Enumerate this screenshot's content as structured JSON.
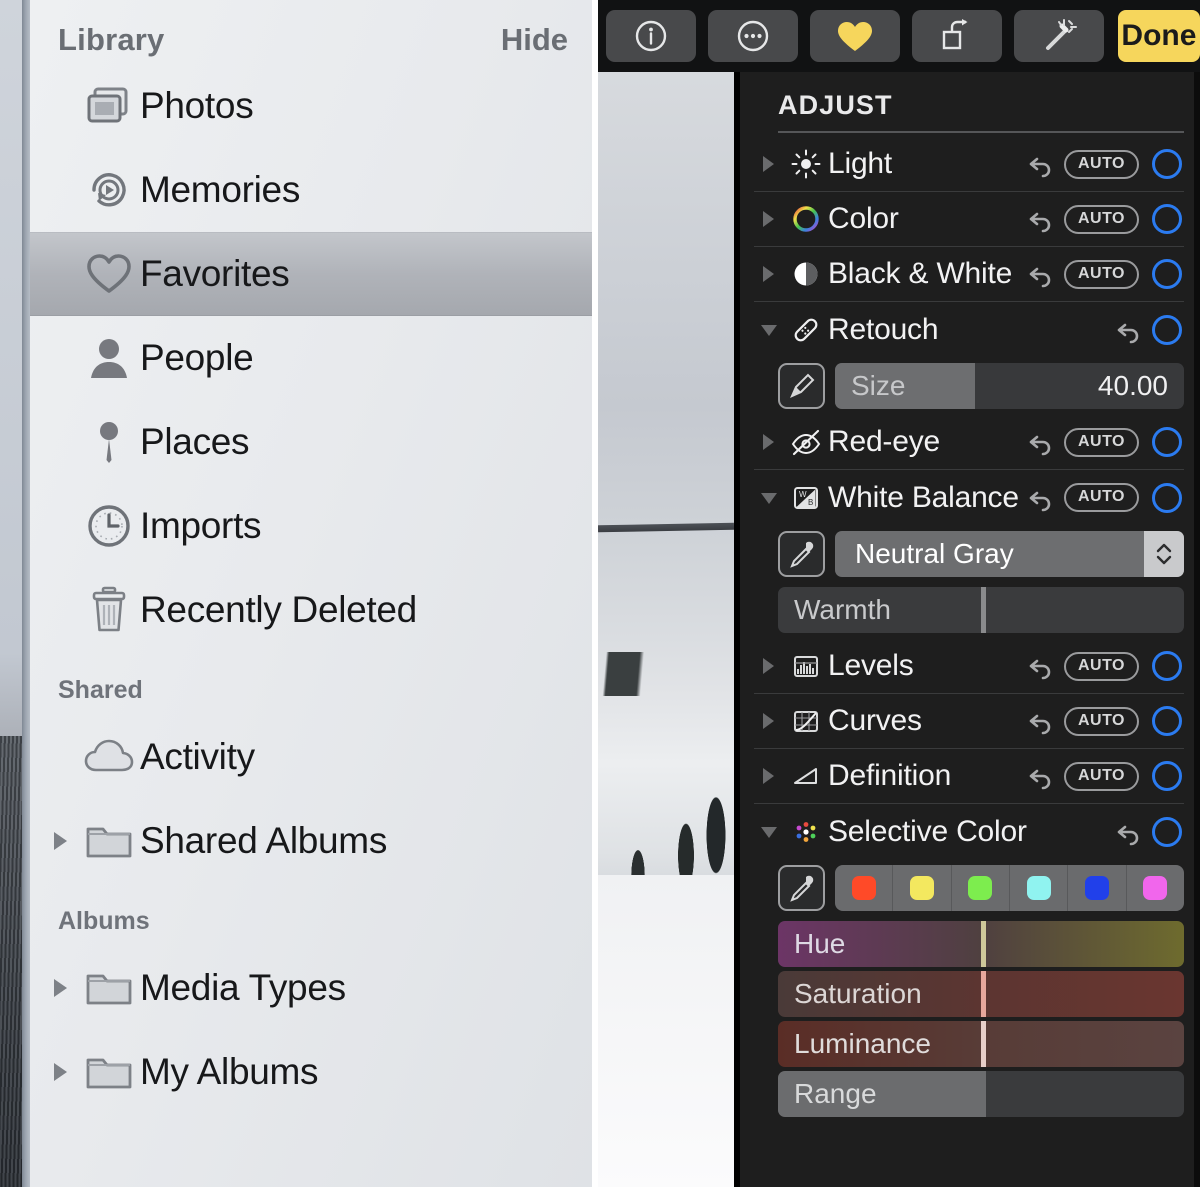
{
  "sidebar": {
    "header": {
      "title": "Library",
      "hide_label": "Hide"
    },
    "library_items": [
      {
        "label": "Photos",
        "icon": "photos-stack-icon",
        "twisty": false,
        "selected": false
      },
      {
        "label": "Memories",
        "icon": "memories-replay-icon",
        "twisty": false,
        "selected": false
      },
      {
        "label": "Favorites",
        "icon": "heart-icon",
        "twisty": false,
        "selected": true
      },
      {
        "label": "People",
        "icon": "person-icon",
        "twisty": false,
        "selected": false
      },
      {
        "label": "Places",
        "icon": "map-pin-icon",
        "twisty": false,
        "selected": false
      },
      {
        "label": "Imports",
        "icon": "clock-icon",
        "twisty": false,
        "selected": false
      },
      {
        "label": "Recently Deleted",
        "icon": "trash-icon",
        "twisty": false,
        "selected": false
      }
    ],
    "shared_title": "Shared",
    "shared_items": [
      {
        "label": "Activity",
        "icon": "cloud-icon",
        "twisty": false,
        "selected": false
      },
      {
        "label": "Shared Albums",
        "icon": "folder-icon",
        "twisty": true,
        "selected": false
      }
    ],
    "albums_title": "Albums",
    "albums_items": [
      {
        "label": "Media Types",
        "icon": "folder-icon",
        "twisty": true,
        "selected": false
      },
      {
        "label": "My Albums",
        "icon": "folder-icon",
        "twisty": true,
        "selected": false
      }
    ]
  },
  "toolbar": {
    "buttons": [
      {
        "name": "info-icon",
        "label": ""
      },
      {
        "name": "more-icon",
        "label": ""
      },
      {
        "name": "favorite-heart-icon",
        "label": ""
      },
      {
        "name": "rotate-icon",
        "label": ""
      },
      {
        "name": "magic-wand-icon",
        "label": ""
      }
    ],
    "done_label": "Done",
    "done_color": "#f6d65c",
    "favorite_color": "#f6d65c"
  },
  "adjust": {
    "panel_title": "ADJUST",
    "auto_label": "AUTO",
    "accent_color": "#2b7bf0",
    "rows": [
      {
        "label": "Light",
        "icon": "brightness-sun-icon",
        "expanded": false,
        "auto": true
      },
      {
        "label": "Color",
        "icon": "color-wheel-icon",
        "expanded": false,
        "auto": true
      },
      {
        "label": "Black & White",
        "icon": "half-circle-icon",
        "expanded": false,
        "auto": true
      },
      {
        "label": "Retouch",
        "icon": "bandage-icon",
        "expanded": true,
        "auto": false
      },
      {
        "label": "Red-eye",
        "icon": "eye-slash-icon",
        "expanded": false,
        "auto": true
      },
      {
        "label": "White Balance",
        "icon": "white-balance-icon",
        "expanded": true,
        "auto": true
      },
      {
        "label": "Levels",
        "icon": "histogram-icon",
        "expanded": false,
        "auto": true
      },
      {
        "label": "Curves",
        "icon": "curves-icon",
        "expanded": false,
        "auto": true
      },
      {
        "label": "Definition",
        "icon": "triangle-definition-icon",
        "expanded": false,
        "auto": true
      },
      {
        "label": "Selective Color",
        "icon": "color-dots-icon",
        "expanded": true,
        "auto": false
      }
    ],
    "retouch": {
      "brush_button": "brush-icon",
      "size_label": "Size",
      "size_value": "40.00",
      "size_fill_percent": 40
    },
    "white_balance": {
      "eyedropper_button": "eyedropper-icon",
      "mode_value": "Neutral Gray",
      "warmth_label": "Warmth",
      "warmth_knob_percent": 50
    },
    "selective_color": {
      "eyedropper_button": "eyedropper-icon",
      "swatches": [
        {
          "name": "red-swatch",
          "color": "#ff4a28"
        },
        {
          "name": "yellow-swatch",
          "color": "#f3e85f"
        },
        {
          "name": "green-swatch",
          "color": "#7ded4e"
        },
        {
          "name": "cyan-swatch",
          "color": "#90f3f0"
        },
        {
          "name": "blue-swatch",
          "color": "#2140ea"
        },
        {
          "name": "magenta-swatch",
          "color": "#f166ec"
        }
      ],
      "sliders": [
        {
          "label": "Hue",
          "knob_percent": 50,
          "from": "#6c3566",
          "to": "#6e6b2e",
          "knob_color": "#cfc89a",
          "text_color": "#ded9e4"
        },
        {
          "label": "Saturation",
          "knob_percent": 50,
          "from": "#4a3a38",
          "to": "#6a3630",
          "knob_color": "#e7a79c",
          "text_color": "#dcd6d5"
        },
        {
          "label": "Luminance",
          "knob_percent": 50,
          "from": "#5a2d26",
          "to": "#5a4340",
          "knob_color": "#e8cfc9",
          "text_color": "#e0dcdb"
        },
        {
          "label": "Range",
          "knob_percent": 50,
          "from": "#6b6c6e",
          "to": "#3a3b3d",
          "knob_color": "#6b6c6e",
          "text_color": "#d9dadb"
        }
      ]
    }
  }
}
